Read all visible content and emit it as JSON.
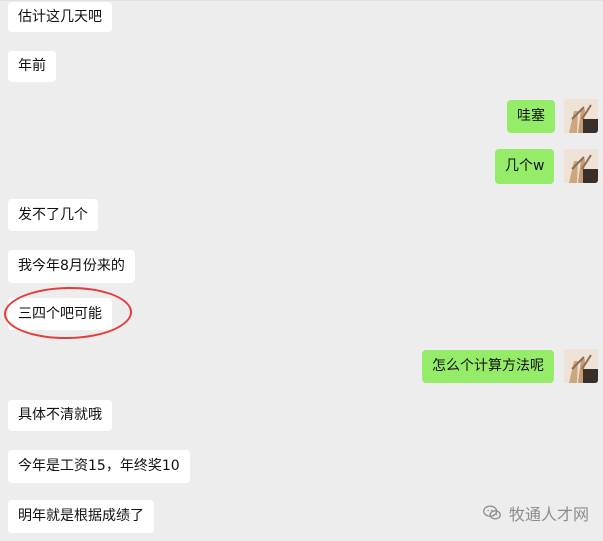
{
  "messages": [
    {
      "text": "估计这几天吧"
    },
    {
      "text": "年前"
    },
    {
      "text": "哇塞"
    },
    {
      "text": "几个w"
    },
    {
      "text": "发不了几个"
    },
    {
      "text": "我今年8月份来的"
    },
    {
      "text": "三四个吧可能"
    },
    {
      "text": "怎么个计算方法呢"
    },
    {
      "text": "具体不清就哦"
    },
    {
      "text": "今年是工资15，年终奖10"
    },
    {
      "text": "明年就是根据成绩了"
    }
  ],
  "watermark": {
    "text": "牧通人才网",
    "icon": "wechat-icon"
  },
  "colors": {
    "background": "#ededed",
    "left_bubble": "#ffffff",
    "right_bubble": "#95ec69",
    "highlight": "#e53b3b"
  }
}
